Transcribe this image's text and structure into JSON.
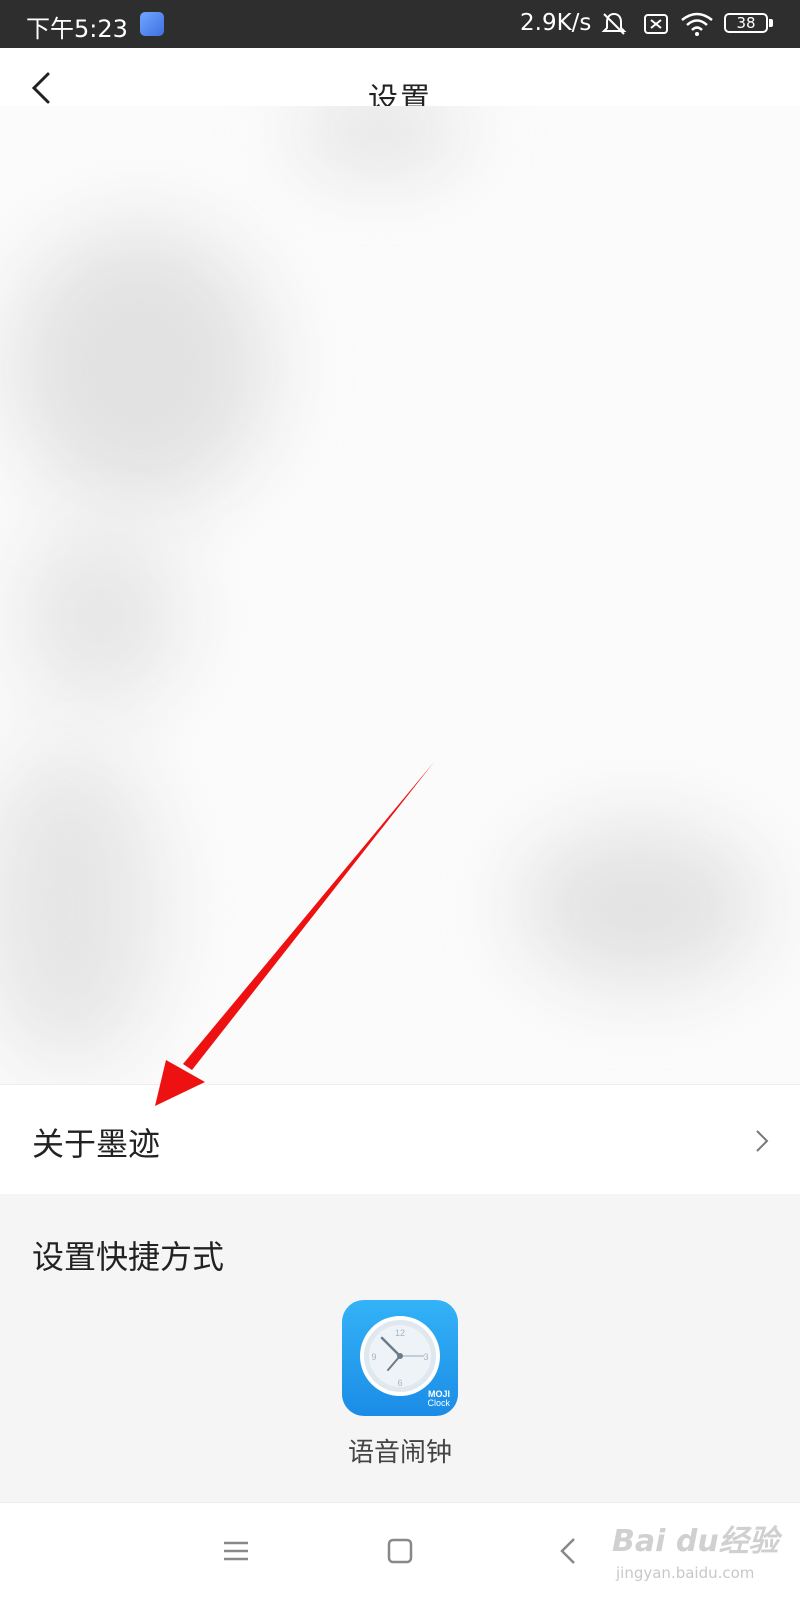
{
  "status_bar": {
    "time": "下午5:23",
    "network_speed": "2.9K/s",
    "battery_level": "38",
    "icons": [
      "app-badge-icon",
      "bell-muted-icon",
      "sim-x-icon",
      "wifi-icon",
      "battery-icon"
    ]
  },
  "header": {
    "title": "设置",
    "back_icon": "chevron-left-icon"
  },
  "settings": {
    "about_label": "关于墨迹",
    "about_chevron": "chevron-right-icon"
  },
  "shortcut": {
    "heading": "设置快捷方式",
    "app_name": "语音闹钟",
    "app_icon_text_line1": "MOJI",
    "app_icon_text_line2": "Clock",
    "clock_numbers": [
      "12",
      "3",
      "6",
      "9"
    ]
  },
  "nav_bar": {
    "icons": [
      "menu-icon",
      "home-square-icon",
      "back-triangle-icon"
    ]
  },
  "watermark": {
    "main": "Bai du经验",
    "url": "jingyan.baidu.com"
  },
  "colors": {
    "status_bar_bg": "#2e2e2e",
    "app_icon_blue": "#1b8ce6",
    "annotation_red": "#ee1111"
  }
}
